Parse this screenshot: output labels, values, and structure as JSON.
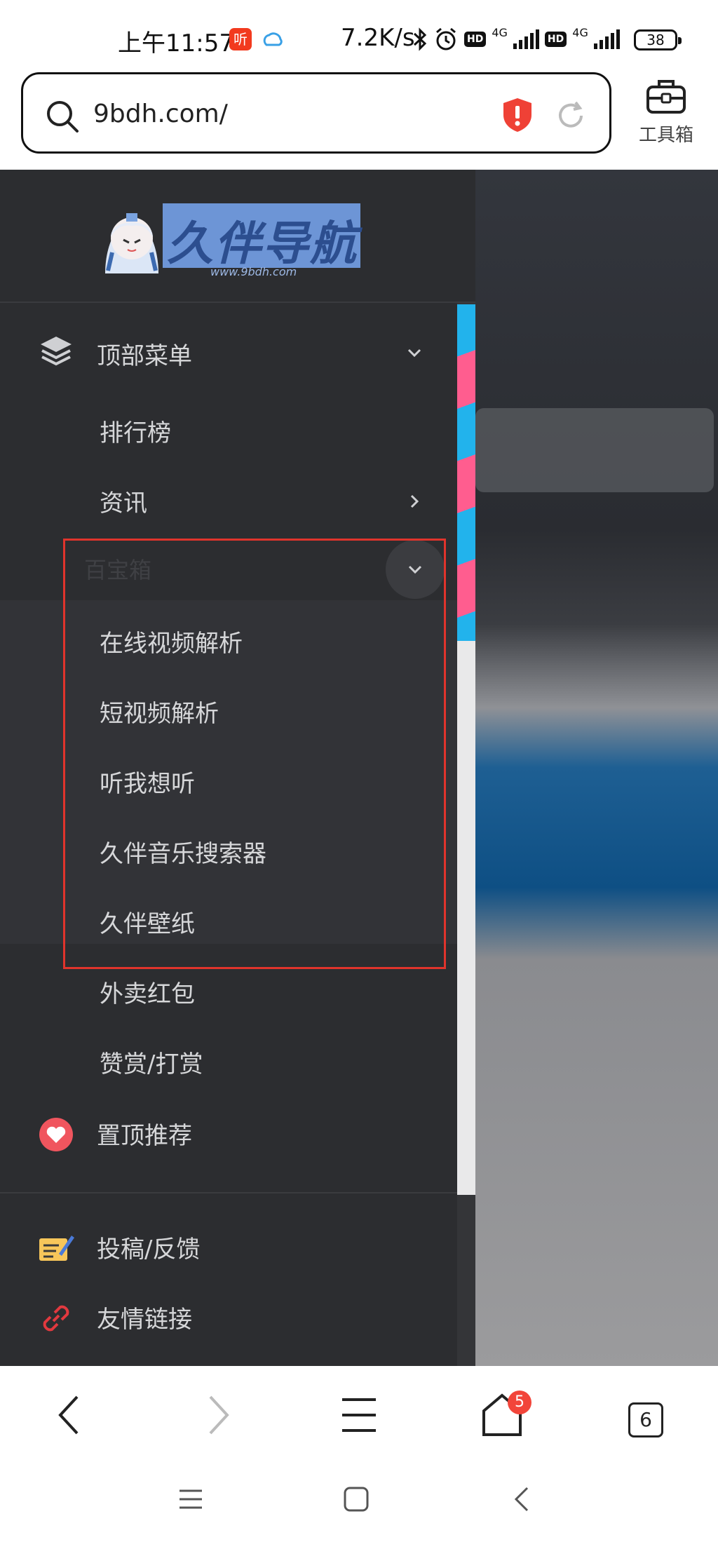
{
  "status_bar": {
    "time": "上午11:57",
    "app_badge": "听",
    "network_speed": "7.2K/s",
    "hd1": "HD",
    "hd2": "HD",
    "net1": "4G",
    "net2": "4G",
    "battery": "38"
  },
  "address_bar": {
    "url": "9bdh.com/",
    "toolbox_label": "工具箱"
  },
  "drawer": {
    "logo_text": "久伴导航",
    "logo_url": "www.9bdh.com",
    "top_menu_label": "顶部菜单",
    "items": [
      {
        "label": "排行榜"
      },
      {
        "label": "资讯"
      },
      {
        "label": "百宝箱"
      },
      {
        "label": "在线视频解析"
      },
      {
        "label": "短视频解析"
      },
      {
        "label": "听我想听"
      },
      {
        "label": "久伴音乐搜索器"
      },
      {
        "label": "久伴壁纸"
      },
      {
        "label": "外卖红包"
      },
      {
        "label": "赞赏/打赏"
      }
    ],
    "pinned_label": "置顶推荐",
    "submit_label": "投稿/反馈",
    "links_label": "友情链接"
  },
  "browser_nav": {
    "home_badge": "5",
    "tabs_count": "6"
  },
  "colors": {
    "drawer_bg": "#2c2d30",
    "highlight_box": "#e0342c",
    "shield": "#ef4136",
    "badge": "#f2453a"
  }
}
